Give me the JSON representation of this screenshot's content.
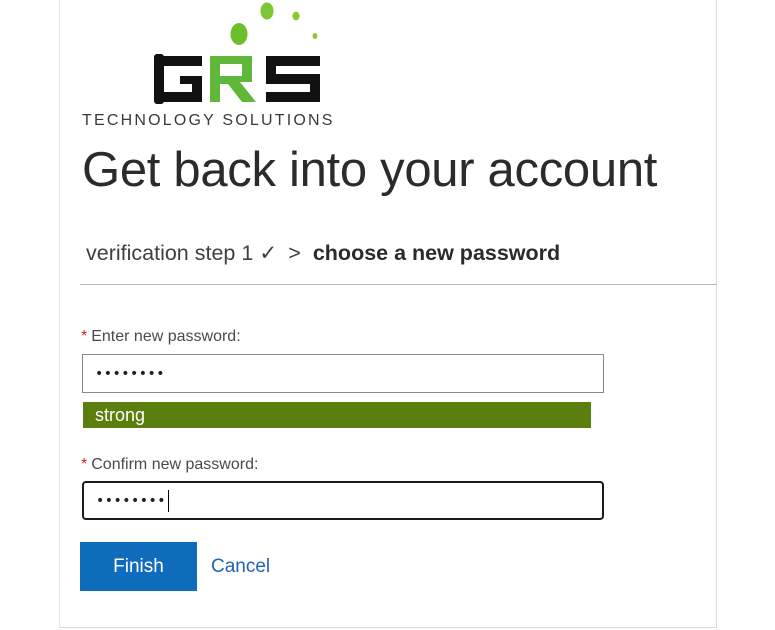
{
  "logo": {
    "letters": "GRS",
    "tagline": "TECHNOLOGY SOLUTIONS",
    "colors": {
      "dark": "#111111",
      "green": "#5fb83a",
      "dot": "#8bc832"
    }
  },
  "page": {
    "title": "Get back into your account"
  },
  "breadcrumb": {
    "step1": "verification step 1",
    "check": "✓",
    "separator": ">",
    "current": "choose a new password"
  },
  "form": {
    "new_password": {
      "required_mark": "*",
      "label": "Enter new password:",
      "value": "••••••••"
    },
    "strength": {
      "label": "strong",
      "color": "#5b7f0e"
    },
    "confirm_password": {
      "required_mark": "*",
      "label": "Confirm new password:",
      "value": "••••••••",
      "focused": true
    }
  },
  "actions": {
    "finish_label": "Finish",
    "cancel_label": "Cancel",
    "primary_color": "#0f6cbd",
    "link_color": "#1f63b5"
  }
}
